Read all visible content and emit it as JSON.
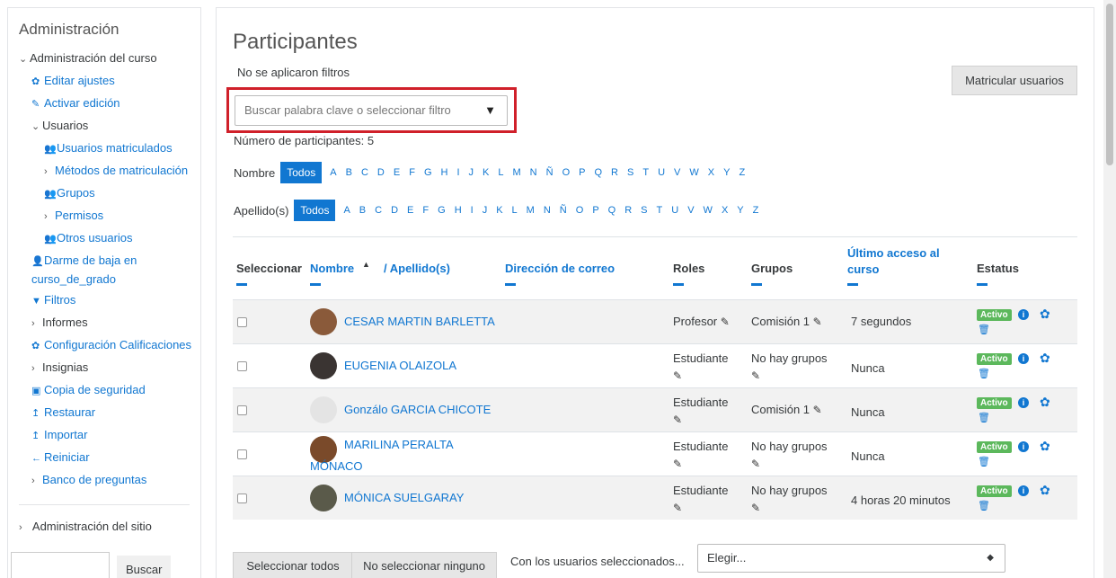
{
  "sidebar": {
    "title": "Administración",
    "items": [
      {
        "label": "Administración del curso",
        "level": 1,
        "chevron": "⌄",
        "icon": "",
        "link": false
      },
      {
        "label": "Editar ajustes",
        "level": 2,
        "chevron": "",
        "icon": "gear-icon",
        "link": true
      },
      {
        "label": "Activar edición",
        "level": 2,
        "chevron": "",
        "icon": "pencil-icon",
        "link": true
      },
      {
        "label": "Usuarios",
        "level": 2,
        "chevron": "⌄",
        "icon": "",
        "link": false
      },
      {
        "label": "Usuarios matriculados",
        "level": 3,
        "chevron": "",
        "icon": "user-plus-icon",
        "link": true
      },
      {
        "label": "Métodos de matriculación",
        "level": 3,
        "chevron": "›",
        "icon": "",
        "link": true,
        "wrap": true
      },
      {
        "label": "Grupos",
        "level": 3,
        "chevron": "",
        "icon": "users-icon",
        "link": true
      },
      {
        "label": "Permisos",
        "level": 3,
        "chevron": "›",
        "icon": "",
        "link": true
      },
      {
        "label": "Otros usuarios",
        "level": 3,
        "chevron": "",
        "icon": "user-plus-icon",
        "link": true
      },
      {
        "label": "Darme de baja en curso_de_grado",
        "level": 2,
        "chevron": "",
        "icon": "user-icon",
        "link": true,
        "wrap": true
      },
      {
        "label": "Filtros",
        "level": 2,
        "chevron": "",
        "icon": "filter-icon",
        "link": true
      },
      {
        "label": "Informes",
        "level": 2,
        "chevron": "›",
        "icon": "",
        "link": false
      },
      {
        "label": "Configuración Calificaciones",
        "level": 2,
        "chevron": "",
        "icon": "gear-icon",
        "link": true,
        "wrap": true
      },
      {
        "label": "Insignias",
        "level": 2,
        "chevron": "›",
        "icon": "",
        "link": false
      },
      {
        "label": "Copia de seguridad",
        "level": 2,
        "chevron": "",
        "icon": "file-icon",
        "link": true
      },
      {
        "label": "Restaurar",
        "level": 2,
        "chevron": "",
        "icon": "upload-icon",
        "link": true
      },
      {
        "label": "Importar",
        "level": 2,
        "chevron": "",
        "icon": "upload-icon",
        "link": true
      },
      {
        "label": "Reiniciar",
        "level": 2,
        "chevron": "",
        "icon": "arrow-left-icon",
        "link": true
      },
      {
        "label": "Banco de preguntas",
        "level": 2,
        "chevron": "›",
        "icon": "",
        "link": true
      }
    ],
    "site_admin": "Administración del sitio",
    "search_button": "Buscar"
  },
  "main": {
    "title": "Participantes",
    "no_filters": "No se aplicaron filtros",
    "enrol_button": "Matricular usuarios",
    "filter_placeholder": "Buscar palabra clave o seleccionar filtro",
    "participant_count": "Número de participantes: 5",
    "first_name_label": "Nombre",
    "last_name_label": "Apellido(s)",
    "all_label": "Todos",
    "letters": [
      "A",
      "B",
      "C",
      "D",
      "E",
      "F",
      "G",
      "H",
      "I",
      "J",
      "K",
      "L",
      "M",
      "N",
      "Ñ",
      "O",
      "P",
      "Q",
      "R",
      "S",
      "T",
      "U",
      "V",
      "W",
      "X",
      "Y",
      "Z"
    ]
  },
  "table": {
    "headers": {
      "select": "Seleccionar",
      "first_name": "Nombre",
      "sort_indicator": "▲",
      "last_name": "/ Apellido(s)",
      "email": "Dirección de correo",
      "roles": "Roles",
      "groups": "Grupos",
      "last_access": "Último acceso al curso",
      "status": "Estatus"
    },
    "rows": [
      {
        "name": "CESAR MARTIN BARLETTA",
        "role": "Profesor",
        "group": "Comisión 1",
        "last_access": "7 segundos",
        "status": "Activo",
        "avatar_color": "#8a5a3a"
      },
      {
        "name": "EUGENIA OLAIZOLA",
        "role": "Estudiante",
        "group": "No hay grupos",
        "last_access": "Nunca",
        "status": "Activo",
        "avatar_color": "#3a3432"
      },
      {
        "name": "Gonzálo GARCIA CHICOTE",
        "role": "Estudiante",
        "group": "Comisión 1",
        "last_access": "Nunca",
        "status": "Activo",
        "avatar_color": "#e4e4e4"
      },
      {
        "name": "MARILINA PERALTA MÓNACO",
        "role": "Estudiante",
        "group": "No hay grupos",
        "last_access": "Nunca",
        "status": "Activo",
        "avatar_color": "#7a4a2a"
      },
      {
        "name": "MÓNICA SUELGARAY",
        "role": "Estudiante",
        "group": "No hay grupos",
        "last_access": "4 horas 20 minutos",
        "status": "Activo",
        "avatar_color": "#5a5a4a"
      }
    ]
  },
  "bottom": {
    "select_all": "Seleccionar todos",
    "select_none": "No seleccionar ninguno",
    "with_selected": "Con los usuarios seleccionados...",
    "choose": "Elegir..."
  },
  "colors": {
    "accent": "#1177d1",
    "highlight": "#d0202a",
    "active_badge": "#5cb85c"
  }
}
